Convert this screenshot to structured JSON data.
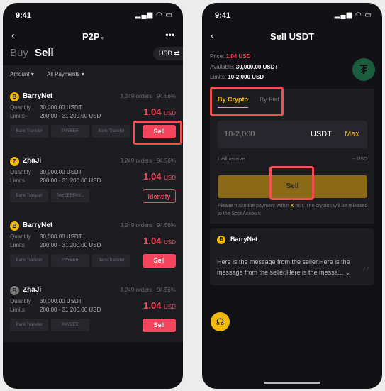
{
  "left": {
    "status": {
      "time": "9:41",
      "icons": "signal wifi battery"
    },
    "header": {
      "title": "P2P",
      "more": "•••"
    },
    "tabs": {
      "buy": "Buy",
      "sell": "Sell"
    },
    "currency": "USD ⇄",
    "filters": {
      "amount": "Amount ▾",
      "payments": "All Payments ▾"
    },
    "listings": [
      {
        "avatar": "B",
        "name": "BarryNet",
        "orders": "3,249 orders",
        "rate": "94.56%",
        "quantity_label": "Quantity",
        "quantity": "30,000.00 USDT",
        "limits_label": "Limits",
        "limits": "200.00 - 31,200.00 USD",
        "price": "1.04",
        "unit": "USD",
        "payments": [
          "Bank Transfer",
          "PAYEER",
          "Bank Transfer"
        ],
        "action": "Sell"
      },
      {
        "avatar": "Z",
        "name": "ZhaJi",
        "orders": "3,249 orders",
        "rate": "94.56%",
        "quantity_label": "Quantity",
        "quantity": "30,000.00 USDT",
        "limits_label": "Limits",
        "limits": "200.00 - 31,200.00 USD",
        "price": "1.04",
        "unit": "USD",
        "payments": [
          "Bank Transfer",
          "PAYEERPAY..."
        ],
        "action": "Identify"
      },
      {
        "avatar": "B",
        "name": "BarryNet",
        "orders": "3,249 orders",
        "rate": "94.56%",
        "quantity_label": "Quantity",
        "quantity": "30,000.00 USDT",
        "limits_label": "Limits",
        "limits": "200.00 - 31,200.00 USD",
        "price": "1.04",
        "unit": "USD",
        "payments": [
          "Bank Transfer",
          "PAYEER",
          "Bank Transfer"
        ],
        "action": "Sell"
      },
      {
        "avatar": "B",
        "name": "ZhaJi",
        "orders": "3,249 orders",
        "rate": "94.56%",
        "quantity_label": "Quantity",
        "quantity": "30,000.00 USDT",
        "limits_label": "Limits",
        "limits": "200.00 - 31,200.00 USD",
        "price": "1.04",
        "unit": "USD",
        "payments": [
          "Bank Transfer",
          "PAYEER"
        ],
        "action": "Sell"
      }
    ]
  },
  "right": {
    "status": {
      "time": "9:41",
      "icons": "signal wifi battery"
    },
    "header": {
      "title": "Sell USDT"
    },
    "price_label": "Price:",
    "price": "1.04 USD",
    "available_label": "Available:",
    "available": "30,000.00 USDT",
    "limits_label": "Limits:",
    "limits": "10-2,000 USD",
    "tabs": [
      "By Crypto",
      "By Fiat"
    ],
    "amount_placeholder": "10-2,000",
    "amount_unit": "USDT",
    "max": "Max",
    "receive_label": "I will receive",
    "receive_value": "-- USD",
    "sell": "Sell",
    "note_pre": "Please make the payment within ",
    "note_x": "X",
    "note_post": " min. The cryptos will be released to the Spot Account",
    "seller": {
      "avatar": "B",
      "name": "BarryNet",
      "message": "Here is the message from the seller,Here is the message from the seller,Here is the messa..."
    }
  },
  "colors": {
    "accent": "#f0b90b",
    "sell_red": "#f6465d",
    "tether": "#1a5c3e",
    "highlight": "#f05050"
  }
}
